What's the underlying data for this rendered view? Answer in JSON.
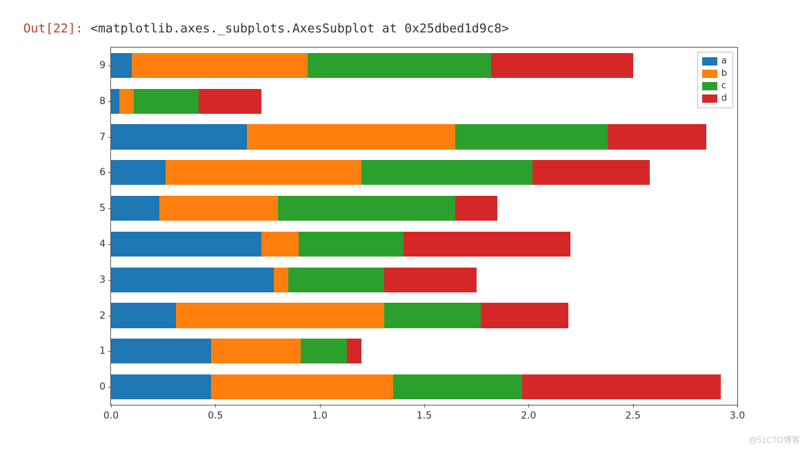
{
  "out_prompt": "Out[22]: ",
  "out_repr": "<matplotlib.axes._subplots.AxesSubplot at 0x25dbed1d9c8>",
  "watermark": "@51CTO博客",
  "chart_data": {
    "type": "bar",
    "orientation": "horizontal",
    "stacked": true,
    "title": "",
    "xlabel": "",
    "ylabel": "",
    "xlim": [
      0.0,
      3.0
    ],
    "categories": [
      "0",
      "1",
      "2",
      "3",
      "4",
      "5",
      "6",
      "7",
      "8",
      "9"
    ],
    "xticks": [
      "0.0",
      "0.5",
      "1.0",
      "1.5",
      "2.0",
      "2.5",
      "3.0"
    ],
    "legend_position": "upper right",
    "series": [
      {
        "name": "a",
        "color": "#1f77b4",
        "values": [
          0.48,
          0.48,
          0.31,
          0.78,
          0.72,
          0.23,
          0.26,
          0.65,
          0.04,
          0.1
        ]
      },
      {
        "name": "b",
        "color": "#ff7f0e",
        "values": [
          0.87,
          0.43,
          1.0,
          0.07,
          0.18,
          0.57,
          0.94,
          1.0,
          0.07,
          0.84
        ]
      },
      {
        "name": "c",
        "color": "#2ca02c",
        "values": [
          0.62,
          0.22,
          0.46,
          0.46,
          0.5,
          0.85,
          0.82,
          0.73,
          0.31,
          0.88
        ]
      },
      {
        "name": "d",
        "color": "#d62728",
        "values": [
          0.95,
          0.07,
          0.42,
          0.44,
          0.8,
          0.2,
          0.56,
          0.47,
          0.3,
          0.68
        ]
      }
    ]
  }
}
